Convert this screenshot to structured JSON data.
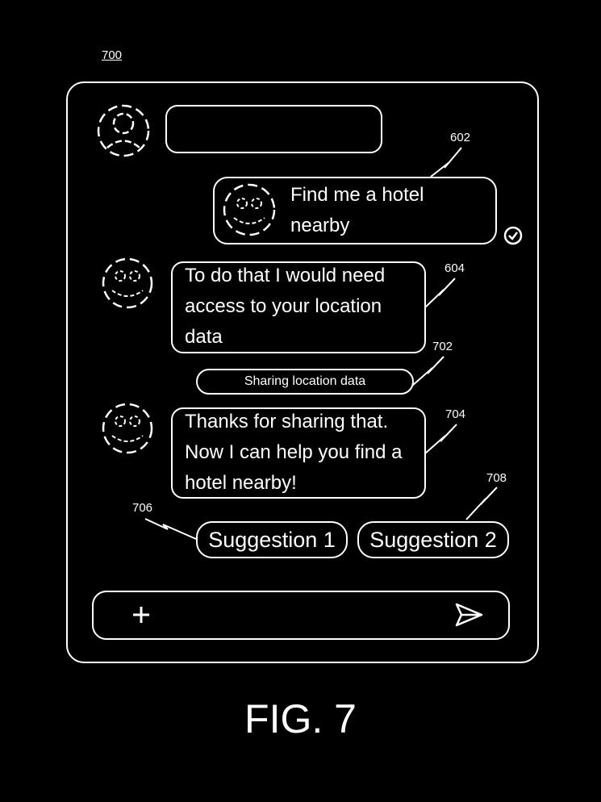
{
  "figure_ref": "700",
  "figure_caption": "FIG. 7",
  "messages": {
    "user_query": {
      "ref": "602",
      "text": "Find me a hotel\nnearby",
      "status_icon": "check-circle-icon"
    },
    "assistant_request": {
      "ref": "604",
      "text": "To do that I would need\naccess to your location\ndata"
    },
    "sharing_notice": {
      "ref": "702",
      "text": "Sharing location data"
    },
    "assistant_thanks": {
      "ref": "704",
      "text": "Thanks for sharing that.\nNow I can help you find a\nhotel nearby!"
    }
  },
  "suggestions": [
    {
      "ref": "706",
      "label": "Suggestion 1"
    },
    {
      "ref": "708",
      "label": "Suggestion 2"
    }
  ],
  "composer": {
    "add_icon": "plus-icon",
    "send_icon": "send-icon"
  },
  "colors": {
    "background": "#000000",
    "foreground": "#ffffff"
  }
}
